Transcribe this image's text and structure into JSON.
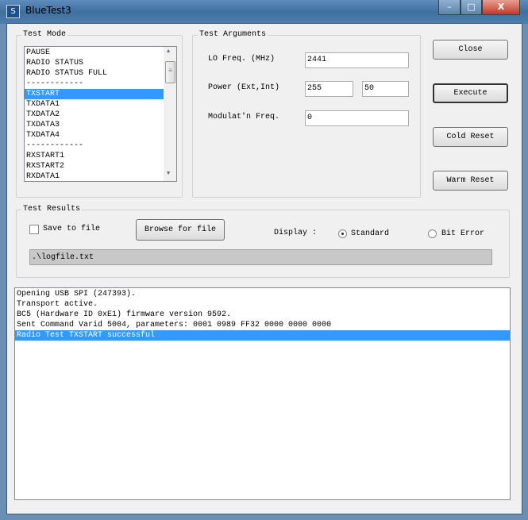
{
  "window": {
    "title": "BlueTest3",
    "minimize": "–",
    "maximize": "□",
    "close": "X"
  },
  "test_mode": {
    "label": "Test Mode",
    "items": [
      "PAUSE",
      "RADIO STATUS",
      "RADIO STATUS FULL",
      "------------",
      "TXSTART",
      "TXDATA1",
      "TXDATA2",
      "TXDATA3",
      "TXDATA4",
      "------------",
      "RXSTART1",
      "RXSTART2",
      "RXDATA1"
    ],
    "selected": "TXSTART"
  },
  "test_arguments": {
    "label": "Test Arguments",
    "lo_freq_label": "LO Freq. (MHz)",
    "lo_freq": "2441",
    "power_label": "Power (Ext,Int)",
    "power_ext": "255",
    "power_int": "50",
    "mod_label": "Modulat'n Freq.",
    "mod_freq": "0"
  },
  "buttons": {
    "close": "Close",
    "execute": "Execute",
    "cold_reset": "Cold Reset",
    "warm_reset": "Warm Reset"
  },
  "test_results": {
    "label": "Test Results",
    "save_label": "Save to file",
    "save_checked": false,
    "browse": "Browse for file",
    "display_label": "Display :",
    "standard": "Standard",
    "bit_error": "Bit Error",
    "display_selected": "Standard",
    "path": ".\\logfile.txt"
  },
  "log": [
    "Opening USB SPI (247393).",
    "Transport active.",
    "BC5 (Hardware ID 0xE1) firmware version 9592.",
    "Sent Command Varid 5004, parameters: 0001 0989 FF32 0000 0000 0000",
    "Radio Test TXSTART successful"
  ],
  "colors": {
    "selection": "#3399ff"
  }
}
